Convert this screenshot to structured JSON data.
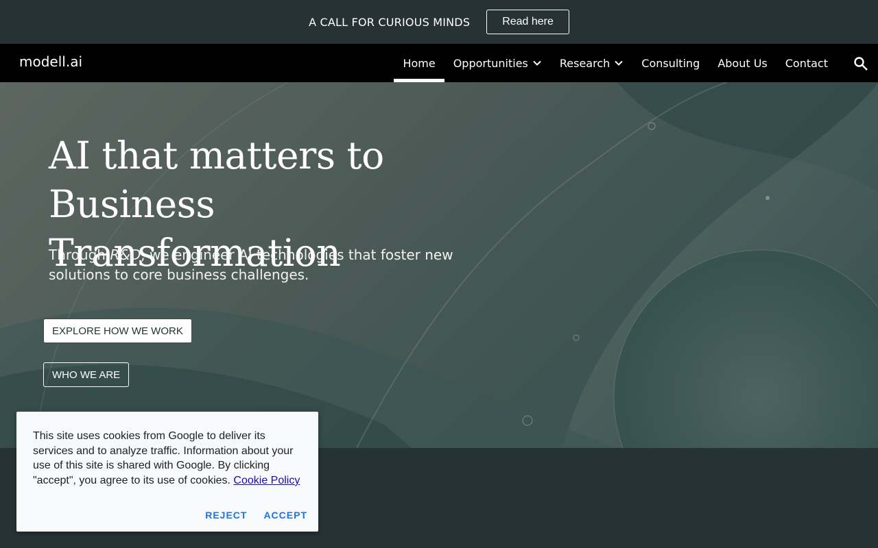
{
  "announcement": {
    "text": "A CALL FOR CURIOUS MINDS",
    "button_label": "Read here"
  },
  "header": {
    "brand": "modell.ai",
    "nav": [
      {
        "label": "Home",
        "active": true,
        "has_dropdown": false
      },
      {
        "label": "Opportunities",
        "active": false,
        "has_dropdown": true
      },
      {
        "label": "Research",
        "active": false,
        "has_dropdown": true
      },
      {
        "label": "Consulting",
        "active": false,
        "has_dropdown": false
      },
      {
        "label": "About Us",
        "active": false,
        "has_dropdown": false
      },
      {
        "label": "Contact",
        "active": false,
        "has_dropdown": false
      }
    ],
    "search_icon": "search-icon"
  },
  "hero": {
    "title_line1": "AI that matters to",
    "title_line2": "Business Transformation",
    "subtitle_pre": "Through ",
    "subtitle_em": "R&D",
    "subtitle_post": ", we engineer AI technologies that foster new solutions to core business challenges.",
    "explore_button": "EXPLORE HOW WE WORK",
    "who_button": "WHO WE ARE"
  },
  "cookie_dialog": {
    "text": "This site uses cookies from Google to deliver its services and to analyze traffic. Information about your use of this site is shared with Google. By clicking \"accept\", you agree to its use of cookies.",
    "policy_link": "Cookie Policy",
    "reject_label": "REJECT",
    "accept_label": "ACCEPT"
  },
  "colors": {
    "page_bg": "#263236",
    "nav_bg": "#000000",
    "accent_link": "#1a73e8"
  }
}
